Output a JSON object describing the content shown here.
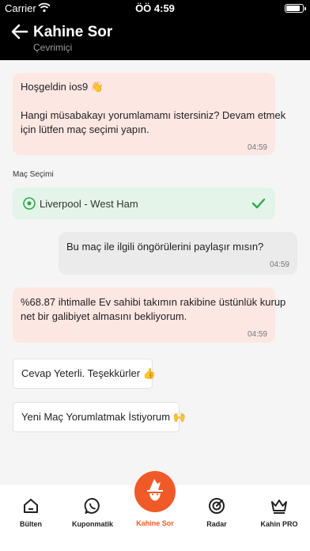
{
  "status": {
    "carrier": "Carrier",
    "time": "ÖÖ 4:59"
  },
  "header": {
    "title": "Kahine Sor",
    "subtitle": "Çevrimiçi"
  },
  "messages": [
    {
      "lines": [
        "Hoşgeldin ios9 👋",
        "",
        "Hangi müsabakayı yorumlamamı istersiniz? Devam etmek",
        "için lütfen maç seçimi yapın."
      ],
      "time": "04:59"
    },
    {
      "text": "Bu maç ile ilgili öngörülerini paylaşır mısın?",
      "time": "04:59"
    },
    {
      "lines": [
        "%68.87 ihtimalle Ev sahibi takımın rakibine üstünlük kurup",
        "net bir galibiyet almasını bekliyorum."
      ],
      "time": "04:59"
    }
  ],
  "match_selection": {
    "label": "Maç Seçimi",
    "selected": "Liverpool - West Ham"
  },
  "quick_replies": [
    "Cevap Yeterli. Teşekkürler 👍",
    "Yeni Maç Yorumlatmak İstiyorum 🙌"
  ],
  "tabs": [
    {
      "label": "Bülten",
      "icon": "home-icon"
    },
    {
      "label": "Kuponmatik",
      "icon": "whatsapp-icon"
    },
    {
      "label": "Kahine Sor",
      "icon": "wizard-icon",
      "active": true
    },
    {
      "label": "Radar",
      "icon": "radar-icon"
    },
    {
      "label": "Kahin PRO",
      "icon": "crown-icon"
    }
  ],
  "colors": {
    "accent": "#f05a28",
    "bot_bubble": "#fde7e3",
    "user_bubble": "#ebebeb",
    "match_bg": "#e4f4e8",
    "check": "#2ea84f"
  }
}
